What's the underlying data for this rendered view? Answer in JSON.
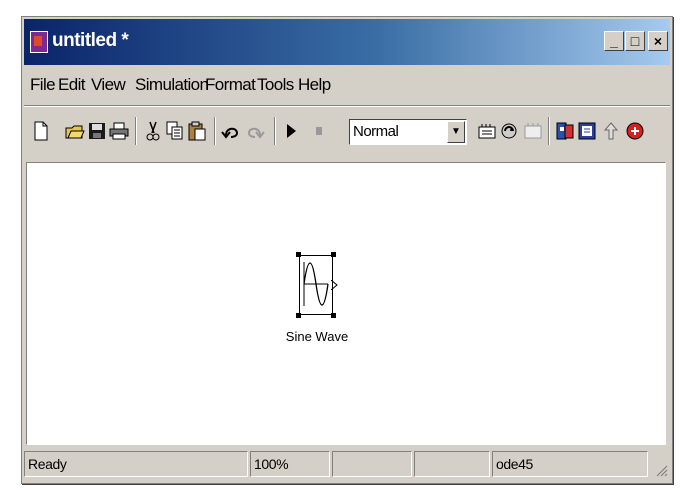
{
  "window": {
    "title": "untitled *"
  },
  "menu": [
    "File",
    "Edit",
    "View",
    "Simulation",
    "Format",
    "Tools",
    "Help"
  ],
  "toolbar": {
    "buttons_left": [
      "new-icon",
      "open-icon",
      "save-icon",
      "print-icon",
      "cut-icon",
      "copy-icon",
      "paste-icon",
      "undo-icon",
      "redo-icon",
      "start-icon",
      "stop-icon"
    ],
    "simulation_mode": "Normal",
    "buttons_right": [
      "build-icon",
      "update-icon",
      "diagram-icon",
      "library-browser-icon",
      "model-explorer-icon",
      "parent-icon",
      "debug-icon"
    ]
  },
  "canvas": {
    "block_label": "Sine Wave"
  },
  "status": {
    "state": "Ready",
    "zoom": "100%",
    "cell3": "",
    "cell4": "",
    "solver": "ode45"
  }
}
